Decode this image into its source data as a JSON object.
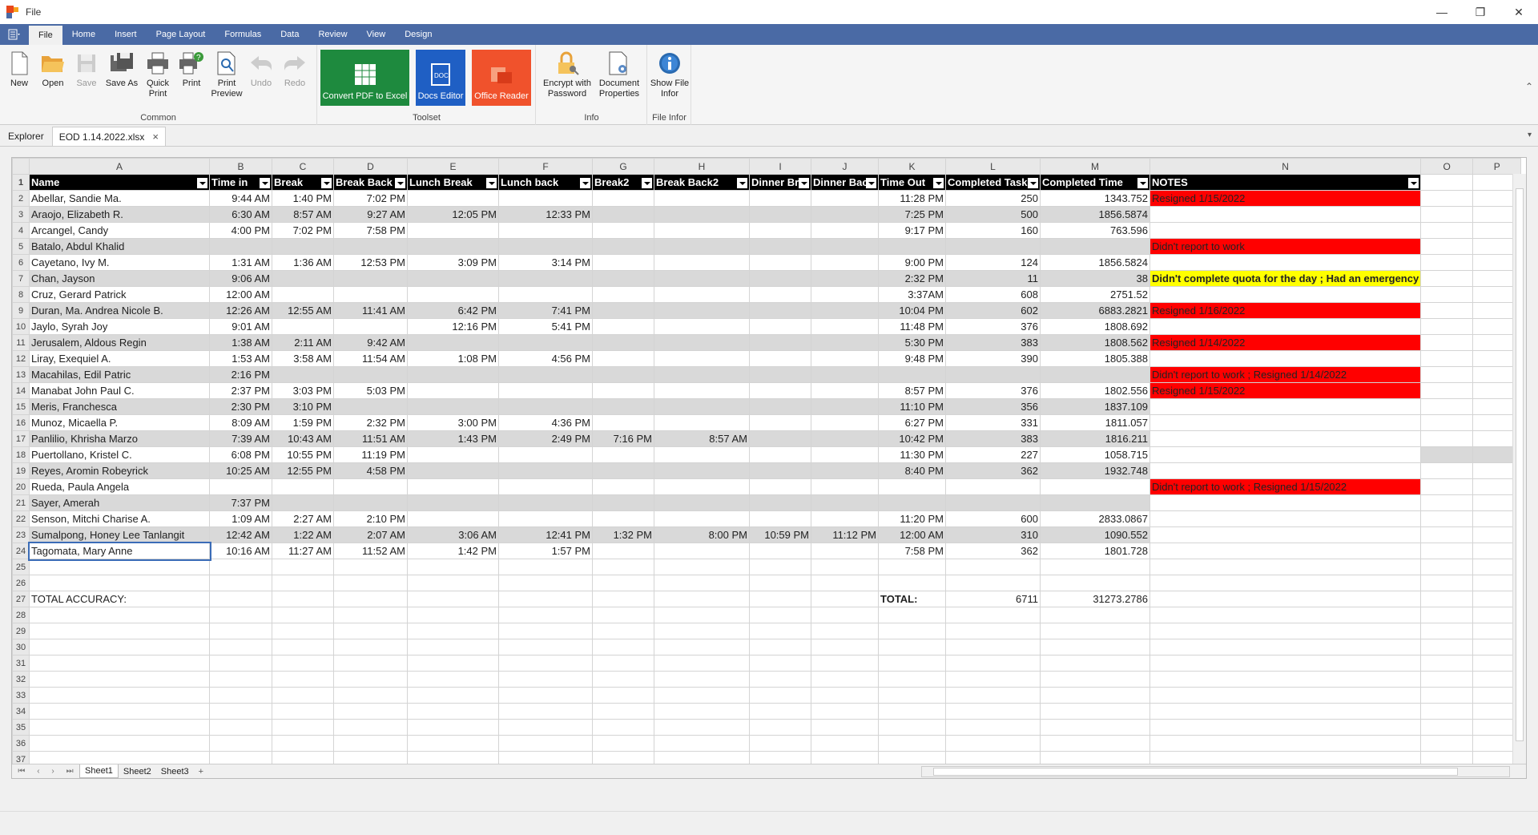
{
  "window": {
    "title": "File",
    "minimize": "—",
    "restore": "❐",
    "close": "✕"
  },
  "menu": {
    "tabs": [
      "File",
      "Home",
      "Insert",
      "Page Layout",
      "Formulas",
      "Data",
      "Review",
      "View",
      "Design"
    ],
    "active": "File"
  },
  "ribbon": {
    "common": {
      "label": "Common",
      "new": "New",
      "open": "Open",
      "save": "Save",
      "save_as": "Save As",
      "quick_print": "Quick Print",
      "print": "Print",
      "print_preview": "Print Preview",
      "undo": "Undo",
      "redo": "Redo"
    },
    "toolset": {
      "label": "Toolset",
      "convert": "Convert PDF to Excel",
      "docs_editor": "Docs Editor",
      "office_reader": "Office Reader"
    },
    "info": {
      "label": "Info",
      "encrypt": "Encrypt with Password",
      "doc_props": "Document Properties"
    },
    "file_infor": {
      "label": "File Infor",
      "show_file_infor": "Show File Infor"
    },
    "colors": {
      "convert": "#1e8a3e",
      "docs_editor": "#1f5fc4",
      "office_reader": "#f0522c"
    }
  },
  "doc_tabs": {
    "explorer": "Explorer",
    "file": "EOD 1.14.2022.xlsx"
  },
  "sheet": {
    "col_letters": [
      "A",
      "B",
      "C",
      "D",
      "E",
      "F",
      "G",
      "H",
      "I",
      "J",
      "K",
      "L",
      "M",
      "N",
      "O",
      "P"
    ],
    "headers": [
      "Name",
      "Time in",
      "Break",
      "Break Back",
      "Lunch Break",
      "Lunch back",
      "Break2",
      "Break Back2",
      "Dinner Br",
      "Dinner Bac",
      "Time Out",
      "Completed Task",
      "Completed Time",
      "NOTES"
    ],
    "rows": [
      [
        "Abellar, Sandie Ma.",
        "9:44 AM",
        "1:40 PM",
        "7:02 PM",
        "",
        "",
        "",
        "",
        "",
        "",
        "11:28 PM",
        "250",
        "1343.752",
        "Resigned 1/15/2022"
      ],
      [
        "Araojo, Elizabeth R.",
        "6:30 AM",
        "8:57 AM",
        "9:27 AM",
        "12:05 PM",
        "12:33 PM",
        "",
        "",
        "",
        "",
        "7:25 PM",
        "500",
        "1856.5874",
        ""
      ],
      [
        "Arcangel, Candy",
        "4:00 PM",
        "7:02 PM",
        "7:58 PM",
        "",
        "",
        "",
        "",
        "",
        "",
        "9:17 PM",
        "160",
        "763.596",
        ""
      ],
      [
        "Batalo, Abdul Khalid",
        "",
        "",
        "",
        "",
        "",
        "",
        "",
        "",
        "",
        "",
        "",
        "",
        "Didn't report to work"
      ],
      [
        "Cayetano, Ivy M.",
        "1:31 AM",
        "1:36 AM",
        "12:53 PM",
        "3:09 PM",
        "3:14 PM",
        "",
        "",
        "",
        "",
        "9:00 PM",
        "124",
        "1856.5824",
        ""
      ],
      [
        "Chan, Jayson",
        "9:06 AM",
        "",
        "",
        "",
        "",
        "",
        "",
        "",
        "",
        "2:32 PM",
        "11",
        "38",
        "Didn't complete quota for the day ; Had an emergency"
      ],
      [
        "Cruz, Gerard Patrick",
        "12:00 AM",
        "",
        "",
        "",
        "",
        "",
        "",
        "",
        "",
        "3:37AM",
        "608",
        "2751.52",
        ""
      ],
      [
        "Duran, Ma. Andrea Nicole B.",
        "12:26 AM",
        "12:55 AM",
        "11:41 AM",
        "6:42 PM",
        "7:41 PM",
        "",
        "",
        "",
        "",
        "10:04 PM",
        "602",
        "6883.2821",
        "Resigned 1/16/2022"
      ],
      [
        "Jaylo, Syrah Joy",
        "9:01 AM",
        "",
        "",
        "12:16 PM",
        "5:41 PM",
        "",
        "",
        "",
        "",
        "11:48 PM",
        "376",
        "1808.692",
        ""
      ],
      [
        "Jerusalem, Aldous Regin",
        "1:38 AM",
        "2:11 AM",
        "9:42 AM",
        "",
        "",
        "",
        "",
        "",
        "",
        "5:30 PM",
        "383",
        "1808.562",
        "Resigned 1/14/2022"
      ],
      [
        "Liray, Exequiel A.",
        "1:53 AM",
        "3:58 AM",
        "11:54 AM",
        "1:08 PM",
        "4:56 PM",
        "",
        "",
        "",
        "",
        "9:48 PM",
        "390",
        "1805.388",
        ""
      ],
      [
        "Macahilas, Edil Patric",
        "2:16 PM",
        "",
        "",
        "",
        "",
        "",
        "",
        "",
        "",
        "",
        "",
        "",
        "Didn't report to work ; Resigned 1/14/2022"
      ],
      [
        "Manabat John Paul C.",
        "2:37 PM",
        "3:03 PM",
        "5:03 PM",
        "",
        "",
        "",
        "",
        "",
        "",
        "8:57 PM",
        "376",
        "1802.556",
        "Resigned 1/15/2022"
      ],
      [
        "Meris, Franchesca",
        "2:30 PM",
        "3:10 PM",
        "",
        "",
        "",
        "",
        "",
        "",
        "",
        "11:10 PM",
        "356",
        "1837.109",
        ""
      ],
      [
        "Munoz, Micaella P.",
        "8:09 AM",
        "1:59 PM",
        "2:32 PM",
        "3:00 PM",
        "4:36 PM",
        "",
        "",
        "",
        "",
        "6:27 PM",
        "331",
        "1811.057",
        ""
      ],
      [
        "Panlilio, Khrisha Marzo",
        "7:39 AM",
        "10:43 AM",
        "11:51 AM",
        "1:43 PM",
        "2:49 PM",
        "7:16 PM",
        "8:57 AM",
        "",
        "",
        "10:42 PM",
        "383",
        "1816.211",
        ""
      ],
      [
        "Puertollano, Kristel C.",
        "6:08 PM",
        "10:55 PM",
        "11:19 PM",
        "",
        "",
        "",
        "",
        "",
        "",
        "11:30 PM",
        "227",
        "1058.715",
        ""
      ],
      [
        "Reyes, Aromin Robeyrick",
        "10:25 AM",
        "12:55 PM",
        "4:58 PM",
        "",
        "",
        "",
        "",
        "",
        "",
        "8:40 PM",
        "362",
        "1932.748",
        ""
      ],
      [
        "Rueda, Paula Angela",
        "",
        "",
        "",
        "",
        "",
        "",
        "",
        "",
        "",
        "",
        "",
        "",
        "Didn't report to work ; Resigned 1/15/2022"
      ],
      [
        "Sayer, Amerah",
        "7:37 PM",
        "",
        "",
        "",
        "",
        "",
        "",
        "",
        "",
        "",
        "",
        "",
        ""
      ],
      [
        "Senson, Mitchi Charise A.",
        "1:09 AM",
        "2:27 AM",
        "2:10 PM",
        "",
        "",
        "",
        "",
        "",
        "",
        "11:20 PM",
        "600",
        "2833.0867",
        ""
      ],
      [
        "Sumalpong, Honey Lee Tanlangit",
        "12:42 AM",
        "1:22 AM",
        "2:07 AM",
        "3:06 AM",
        "12:41 PM",
        "1:32 PM",
        "8:00 PM",
        "10:59 PM",
        "11:12 PM",
        "12:00 AM",
        "310",
        "1090.552",
        ""
      ],
      [
        "Tagomata, Mary Anne",
        "10:16 AM",
        "11:27 AM",
        "11:52 AM",
        "1:42 PM",
        "1:57 PM",
        "",
        "",
        "",
        "",
        "7:58 PM",
        "362",
        "1801.728",
        ""
      ]
    ],
    "totals": {
      "accuracy_label": "TOTAL ACCURACY:",
      "total_label": "TOTAL:",
      "total_tasks": "6711",
      "total_time": "31273.2786"
    },
    "sheet_tabs": [
      "Sheet1",
      "Sheet2",
      "Sheet3"
    ],
    "add_sheet": "+",
    "note_red": "#ff0000",
    "note_yellow": "#ffff00"
  }
}
